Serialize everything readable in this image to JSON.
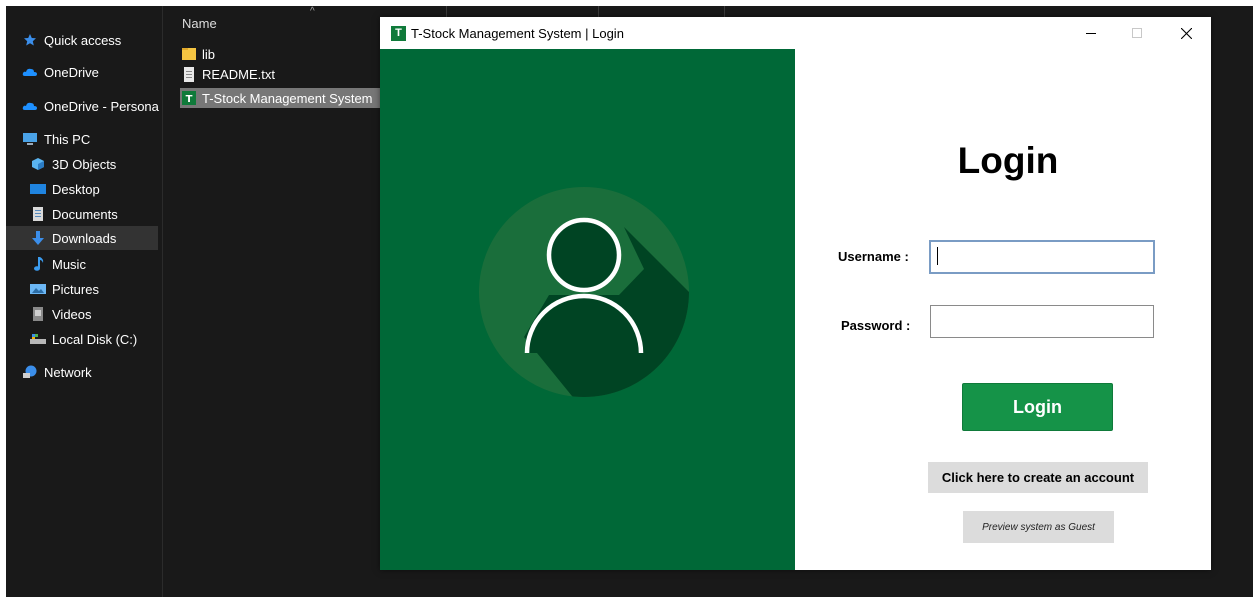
{
  "explorer": {
    "nav_items": [
      {
        "label": "Quick access",
        "icon": "star-icon"
      },
      {
        "label": "OneDrive",
        "icon": "cloud-icon"
      },
      {
        "label": "OneDrive - Persona",
        "icon": "cloud-icon"
      },
      {
        "label": "This PC",
        "icon": "computer-icon"
      },
      {
        "label": "3D Objects",
        "icon": "cube-icon"
      },
      {
        "label": "Desktop",
        "icon": "desktop-icon"
      },
      {
        "label": "Documents",
        "icon": "document-icon"
      },
      {
        "label": "Downloads",
        "icon": "download-arrow-icon",
        "selected": true
      },
      {
        "label": "Music",
        "icon": "music-note-icon"
      },
      {
        "label": "Pictures",
        "icon": "picture-icon"
      },
      {
        "label": "Videos",
        "icon": "video-icon"
      },
      {
        "label": "Local Disk (C:)",
        "icon": "drive-icon"
      },
      {
        "label": "Network",
        "icon": "network-icon"
      }
    ],
    "column_header": "Name",
    "files": [
      {
        "name": "lib",
        "icon": "folder-icon"
      },
      {
        "name": "README.txt",
        "icon": "text-file-icon"
      },
      {
        "name": "T-Stock Management System",
        "icon": "app-icon",
        "selected": true
      }
    ]
  },
  "login_window": {
    "title": "T-Stock Management System | Login",
    "app_icon_letter": "T",
    "heading": "Login",
    "username_label": "Username :",
    "username_value": "",
    "password_label": "Password :",
    "password_value": "",
    "login_button": "Login",
    "create_account_button": "Click here to create an account",
    "guest_button": "Preview system as Guest",
    "colors": {
      "panel_green": "#006837",
      "button_green": "#159348",
      "avatar_circle": "#1a6e3b",
      "avatar_shadow": "#004423"
    }
  }
}
